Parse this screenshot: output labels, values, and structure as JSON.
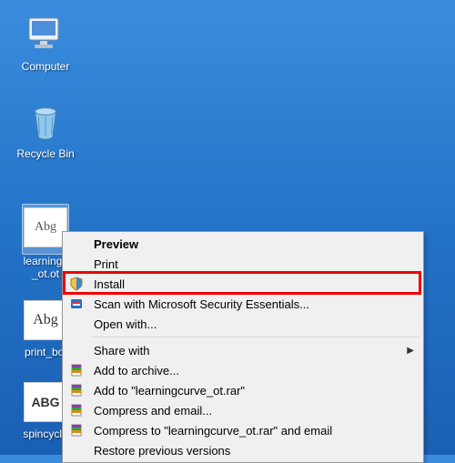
{
  "desktop": {
    "computer_label": "Computer",
    "recycle_label": "Recycle Bin",
    "font1_label": "learningc _ot.ot",
    "font1_sample": "Abg",
    "font2_label": "print_bol",
    "font2_sample": "Abg",
    "font3_label": "spincycle",
    "font3_sample": "ABG"
  },
  "menu": {
    "preview": "Preview",
    "print": "Print",
    "install": "Install",
    "scan": "Scan with Microsoft Security Essentials...",
    "open_with": "Open with...",
    "share_with": "Share with",
    "add_archive": "Add to archive...",
    "add_named": "Add to \"learningcurve_ot.rar\"",
    "compress_email": "Compress and email...",
    "compress_named_email": "Compress to \"learningcurve_ot.rar\" and email",
    "restore_prev": "Restore previous versions"
  }
}
